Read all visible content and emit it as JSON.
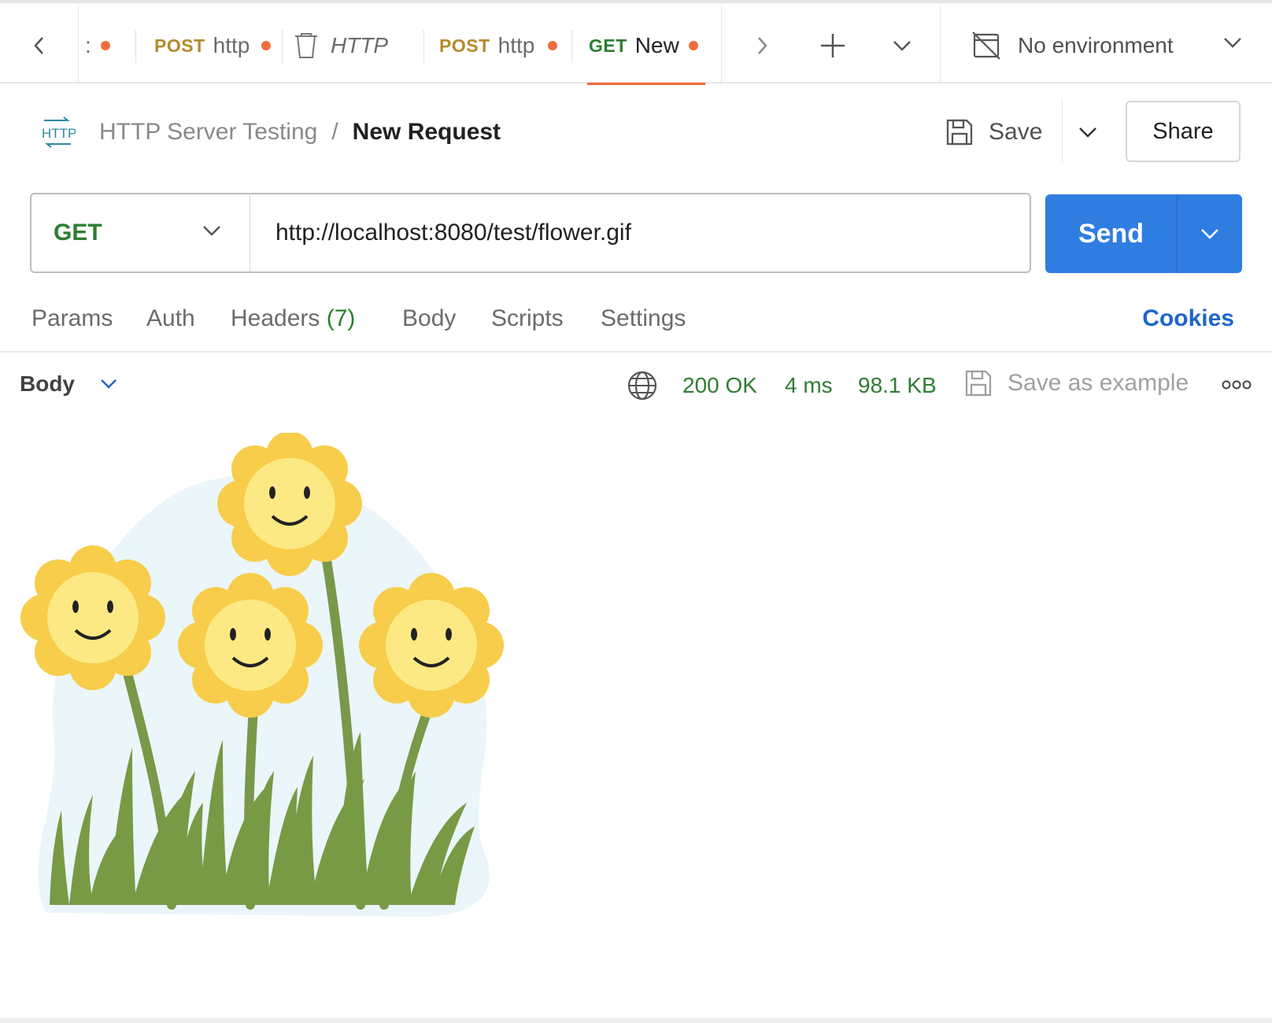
{
  "tabs": [
    {
      "method": "",
      "name": ":",
      "dirty": true
    },
    {
      "method": "POST",
      "name": "http",
      "dirty": true
    },
    {
      "method": "",
      "name": "HTTP",
      "dirty": false
    },
    {
      "method": "POST",
      "name": "http",
      "dirty": true
    },
    {
      "method": "GET",
      "name": "New",
      "dirty": true
    }
  ],
  "environment": {
    "label": "No environment"
  },
  "breadcrumb": {
    "icon_text": "HTTP",
    "collection": "HTTP Server Testing",
    "separator": "/",
    "request": "New Request"
  },
  "actions": {
    "save_label": "Save",
    "share_label": "Share"
  },
  "request": {
    "method": "GET",
    "url": "http://localhost:8080/test/flower.gif",
    "send_label": "Send"
  },
  "request_tabs": {
    "params": "Params",
    "auth": "Auth",
    "headers": "Headers",
    "headers_count": "(7)",
    "body": "Body",
    "scripts": "Scripts",
    "settings": "Settings",
    "cookies": "Cookies"
  },
  "response": {
    "view_label": "Body",
    "status": "200 OK",
    "time": "4 ms",
    "size": "98.1 KB",
    "save_example_label": "Save as example"
  },
  "colors": {
    "accent_orange": "#ef6c3c",
    "send_blue": "#2f7de1",
    "get_green": "#2e7d32",
    "post_gold": "#b48a2c",
    "cookies_blue": "#1f66c9"
  }
}
